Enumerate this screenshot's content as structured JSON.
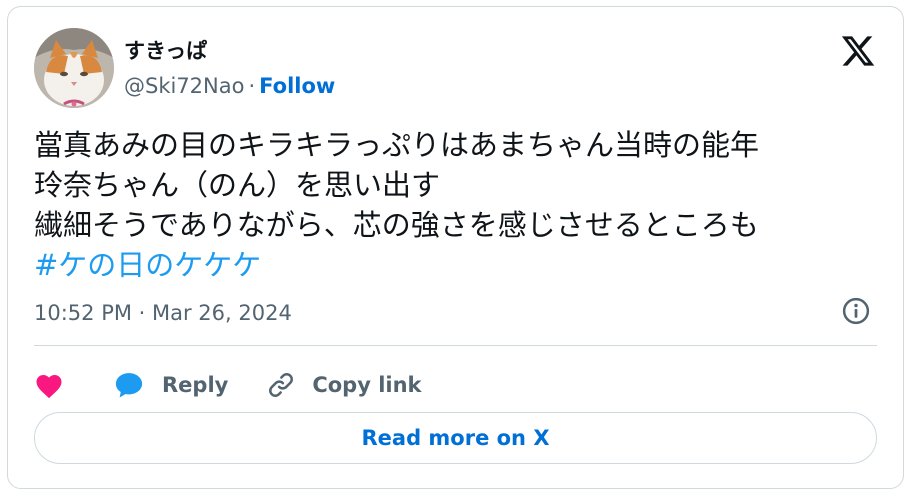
{
  "author": {
    "display_name": "すきっぱ",
    "handle": "@Ski72Nao",
    "separator": "·",
    "follow_label": "Follow"
  },
  "tweet": {
    "lines": [
      "當真あみの目のキラキラっぷりはあまちゃん当時の能年",
      "玲奈ちゃん（のん）を思い出す",
      "繊細そうでありながら、芯の強さを感じさせるところも"
    ],
    "hashtag": "#ケの日のケケケ",
    "timestamp": "10:52 PM · Mar 26, 2024"
  },
  "actions": {
    "reply_label": "Reply",
    "copy_link_label": "Copy link"
  },
  "read_more_label": "Read more on X",
  "colors": {
    "link_blue": "#006fd6",
    "hashtag_blue": "#1d9bf0",
    "like_red": "#f91880",
    "reply_blue": "#1d9bf0",
    "secondary_text": "#536471",
    "border": "#cfd9de"
  },
  "icons": {
    "brand": "x-logo-icon",
    "info": "info-icon",
    "like": "heart-icon",
    "reply": "speech-bubble-icon",
    "copy_link": "link-icon"
  }
}
